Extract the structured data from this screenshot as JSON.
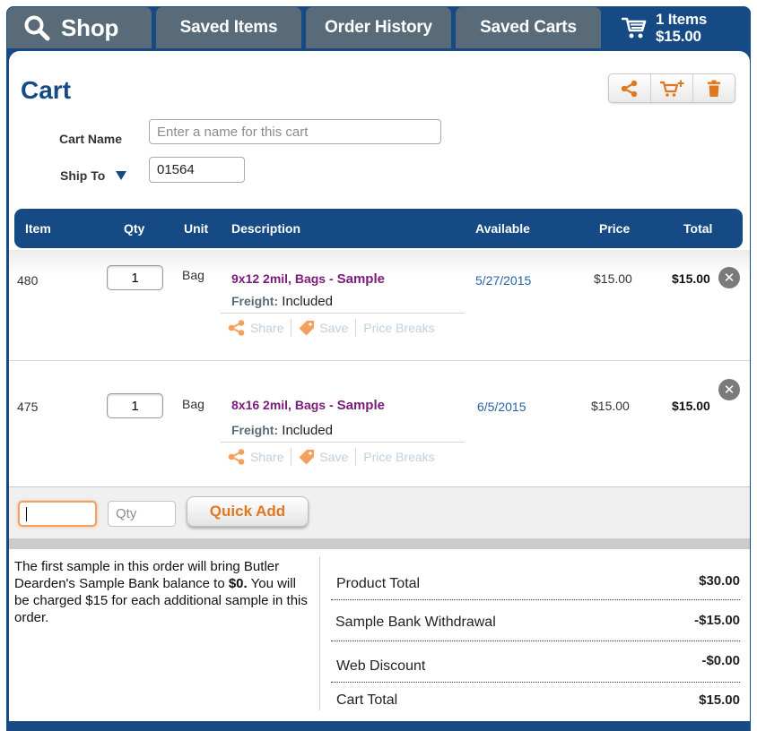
{
  "tabs": {
    "shop": "Shop",
    "saved_items": "Saved Items",
    "order_history": "Order History",
    "saved_carts": "Saved Carts",
    "cart_items": "1 Items",
    "cart_total": "$15.00"
  },
  "page": {
    "title": "Cart"
  },
  "form": {
    "cart_name_label": "Cart Name",
    "cart_name_placeholder": "Enter a name for this cart",
    "ship_to_label": "Ship To",
    "ship_to_value": "01564"
  },
  "table": {
    "headers": {
      "item": "Item",
      "qty": "Qty",
      "unit": "Unit",
      "description": "Description",
      "available": "Available",
      "price": "Price",
      "total": "Total"
    },
    "rows": [
      {
        "item": "480",
        "qty": "1",
        "unit": "Bag",
        "title": "9x12 2mil, Bags -",
        "sample": "Sample",
        "freight_label": "Freight:",
        "freight_value": "Included",
        "available": "5/27/2015",
        "price": "$15.00",
        "total": "$15.00"
      },
      {
        "item": "475",
        "qty": "1",
        "unit": "Bag",
        "title": "8x16 2mil, Bags -",
        "sample": "Sample",
        "freight_label": "Freight:",
        "freight_value": "Included",
        "available": "6/5/2015",
        "price": "$15.00",
        "total": "$15.00"
      }
    ],
    "actions": {
      "share": "Share",
      "save": "Save",
      "price_breaks": "Price Breaks"
    }
  },
  "quick_add": {
    "qty_placeholder": "Qty",
    "button": "Quick Add"
  },
  "note": {
    "pre": "The first sample in this order will bring Butler Dearden's Sample Bank balance to ",
    "amount": "$0.",
    "post": " You will be charged $15 for each additional sample in this order."
  },
  "summary": {
    "product_total_label": "Product Total",
    "product_total_value": "$30.00",
    "sample_bank_label": "Sample Bank Withdrawal",
    "sample_bank_value": "-$15.00",
    "web_discount_label": "Web Discount",
    "web_discount_value": "-$0.00",
    "cart_total_label": "Cart Total",
    "cart_total_value": "$15.00"
  },
  "colors": {
    "brand_blue": "#154a85",
    "tab_gray": "#596b78",
    "accent_orange": "#e07820",
    "sample_purple": "#7a1a7a",
    "link_blue": "#2563a8"
  },
  "icons": [
    "search-icon",
    "cart-icon",
    "share-icon",
    "add-to-cart-icon",
    "trash-icon",
    "tag-icon",
    "close-icon",
    "dropdown-triangle-icon"
  ]
}
